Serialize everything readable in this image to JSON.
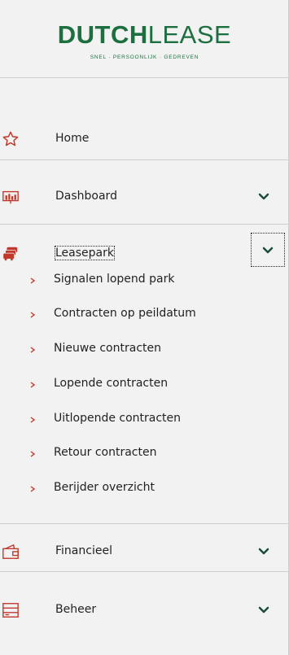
{
  "brand": {
    "name_bold": "DUTCH",
    "name_light": "LEASE",
    "tagline": "SNEL · PERSOONLIJK · GEDREVEN",
    "color": "#1d6f3f"
  },
  "accent_color": "#c0392b",
  "nav": {
    "home": {
      "label": "Home",
      "icon": "star-icon"
    },
    "dashboard": {
      "label": "Dashboard",
      "icon": "chart-icon",
      "expandable": true
    },
    "leasepark": {
      "label": "Leasepark",
      "icon": "car-stack-icon",
      "expanded": true,
      "children": [
        {
          "label": "Signalen lopend park"
        },
        {
          "label": "Contracten op peildatum"
        },
        {
          "label": "Nieuwe contracten"
        },
        {
          "label": "Lopende contracten"
        },
        {
          "label": "Uitlopende contracten"
        },
        {
          "label": "Retour contracten"
        },
        {
          "label": "Berijder overzicht"
        }
      ]
    },
    "financieel": {
      "label": "Financieel",
      "icon": "wallet-icon",
      "expandable": true
    },
    "beheer": {
      "label": "Beheer",
      "icon": "list-icon",
      "expandable": true
    }
  }
}
